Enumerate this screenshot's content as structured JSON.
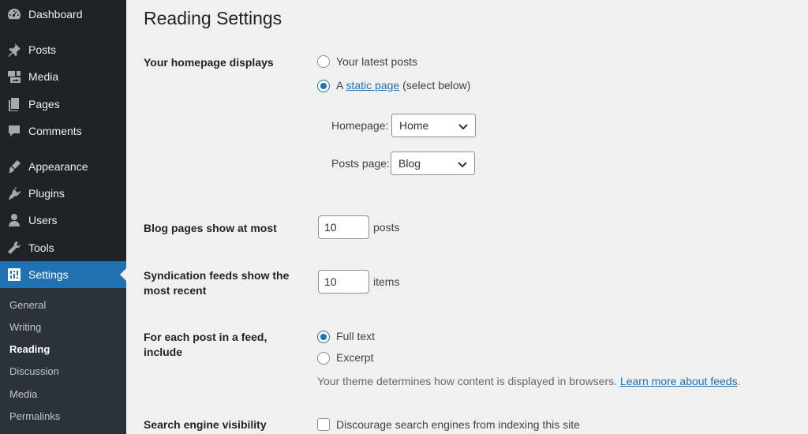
{
  "sidebar": {
    "menu": [
      {
        "label": "Dashboard",
        "icon": "dashboard-icon"
      },
      {
        "label": "Posts",
        "icon": "pin-icon"
      },
      {
        "label": "Media",
        "icon": "media-icon"
      },
      {
        "label": "Pages",
        "icon": "pages-icon"
      },
      {
        "label": "Comments",
        "icon": "comment-icon"
      },
      {
        "label": "Appearance",
        "icon": "brush-icon"
      },
      {
        "label": "Plugins",
        "icon": "plugin-icon"
      },
      {
        "label": "Users",
        "icon": "user-icon"
      },
      {
        "label": "Tools",
        "icon": "wrench-icon"
      },
      {
        "label": "Settings",
        "icon": "settings-icon"
      }
    ],
    "submenu": [
      "General",
      "Writing",
      "Reading",
      "Discussion",
      "Media",
      "Permalinks"
    ]
  },
  "page": {
    "title": "Reading Settings"
  },
  "homepage": {
    "label": "Your homepage displays",
    "option_latest": "Your latest posts",
    "option_static_prefix": "A",
    "option_static_link": "static page",
    "option_static_suffix": "(select below)",
    "homepage_label": "Homepage:",
    "homepage_value": "Home",
    "postspage_label": "Posts page:",
    "postspage_value": "Blog"
  },
  "blog_pages": {
    "label": "Blog pages show at most",
    "value": "10",
    "suffix": "posts"
  },
  "syndication": {
    "label": "Syndication feeds show the most recent",
    "value": "10",
    "suffix": "items"
  },
  "feed_include": {
    "label": "For each post in a feed, include",
    "option_full": "Full text",
    "option_excerpt": "Excerpt",
    "desc": "Your theme determines how content is displayed in browsers.",
    "desc_link": "Learn more about feeds",
    "desc_end": "."
  },
  "search": {
    "label": "Search engine visibility",
    "checkbox_label": "Discourage search engines from indexing this site"
  },
  "colors": {
    "sidebar_bg": "#1d2327",
    "submenu_bg": "#2c3338",
    "accent": "#2271b1",
    "page_bg": "#f0f0f1"
  }
}
